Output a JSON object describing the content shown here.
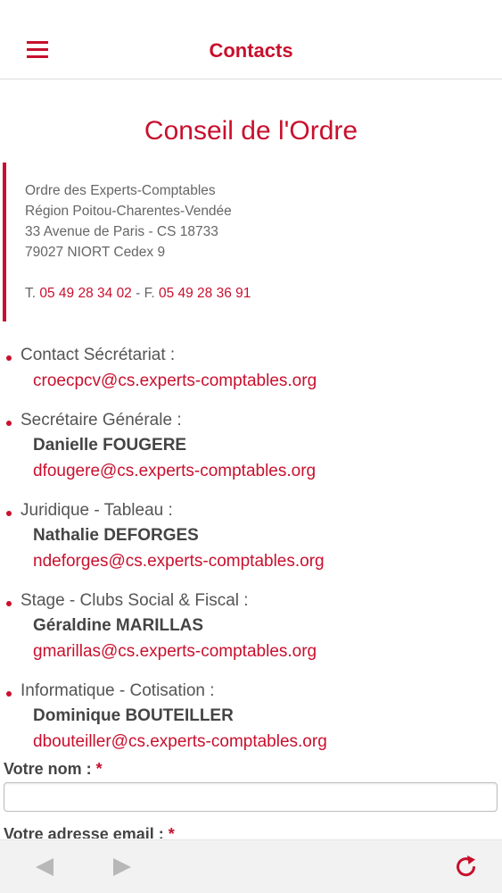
{
  "header": {
    "title": "Contacts",
    "menu_icon": "hamburger-menu-icon"
  },
  "section": {
    "title": "Conseil de l'Ordre"
  },
  "address": {
    "lines": [
      "Ordre des Experts-Comptables",
      "Région Poitou-Charentes-Vendée",
      "33 Avenue de Paris - CS 18733",
      "79027 NIORT Cedex 9"
    ],
    "phone_prefix": "T. ",
    "phone": "05 49 28 34 02",
    "fax_prefix": " - F. ",
    "fax": "05 49 28 36 91"
  },
  "contacts": [
    {
      "label": "Contact Sécrétariat :",
      "name": "",
      "email": "croecpcv@cs.experts-comptables.org"
    },
    {
      "label": "Secrétaire Générale :",
      "name": "Danielle FOUGERE",
      "email": "dfougere@cs.experts-comptables.org"
    },
    {
      "label": "Juridique - Tableau :",
      "name": "Nathalie DEFORGES",
      "email": "ndeforges@cs.experts-comptables.org"
    },
    {
      "label": "Stage - Clubs Social & Fiscal :",
      "name": "Géraldine MARILLAS",
      "email": "gmarillas@cs.experts-comptables.org"
    },
    {
      "label": "Informatique - Cotisation :",
      "name": "Dominique BOUTEILLER",
      "email": "dbouteiller@cs.experts-comptables.org"
    }
  ],
  "form": {
    "name_label": "Votre nom : ",
    "email_label": "Votre adresse email : ",
    "required_mark": "*",
    "name_value": ""
  },
  "colors": {
    "accent": "#c8102e",
    "text": "#555555",
    "bar": "#f2f2f2"
  },
  "bottom_bar": {
    "back_icon": "back-arrow-icon",
    "forward_icon": "forward-arrow-icon",
    "refresh_icon": "refresh-icon"
  }
}
